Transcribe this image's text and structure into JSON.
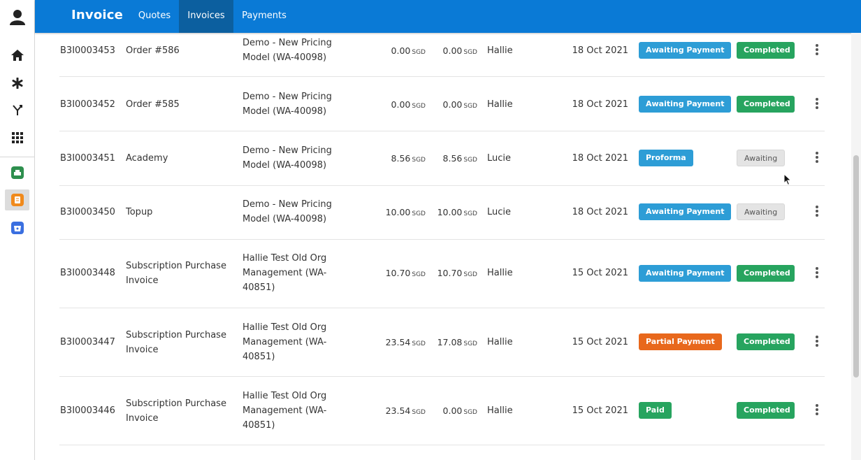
{
  "app": {
    "brand": "Invoice"
  },
  "nav_tabs": [
    {
      "label": "Quotes"
    },
    {
      "label": "Invoices"
    },
    {
      "label": "Payments"
    }
  ],
  "sidebar": {
    "icons": [
      "user-icon",
      "home-icon",
      "asterisk-icon",
      "branch-icon",
      "grid-icon",
      "green-app-icon",
      "orange-app-icon",
      "blue-app-icon"
    ]
  },
  "colors": {
    "topbar": "#0a7ad6",
    "active_tab": "#0c5f9f",
    "awaiting_payment": "#2d9dd6",
    "partial_payment": "#e8681c",
    "paid_completed": "#27a45f",
    "awaiting_gray": "#e4e4e4"
  },
  "rows": [
    {
      "id": "B3I0003453",
      "title": [
        "Order #586"
      ],
      "org": [
        "Demo - New Pricing",
        "Model (WA-40098)"
      ],
      "total": "0.00",
      "total_cur": "SGD",
      "due": "0.00",
      "due_cur": "SGD",
      "owner": "Hallie",
      "date": "18 Oct 2021",
      "status": "Awaiting Payment",
      "state": "Completed"
    },
    {
      "id": "B3I0003452",
      "title": [
        "Order #585"
      ],
      "org": [
        "Demo - New Pricing",
        "Model (WA-40098)"
      ],
      "total": "0.00",
      "total_cur": "SGD",
      "due": "0.00",
      "due_cur": "SGD",
      "owner": "Hallie",
      "date": "18 Oct 2021",
      "status": "Awaiting Payment",
      "state": "Completed"
    },
    {
      "id": "B3I0003451",
      "title": [
        "Academy"
      ],
      "org": [
        "Demo - New Pricing",
        "Model (WA-40098)"
      ],
      "total": "8.56",
      "total_cur": "SGD",
      "due": "8.56",
      "due_cur": "SGD",
      "owner": "Lucie",
      "date": "18 Oct 2021",
      "status": "Proforma",
      "state": "Awaiting"
    },
    {
      "id": "B3I0003450",
      "title": [
        "Topup"
      ],
      "org": [
        "Demo - New Pricing",
        "Model (WA-40098)"
      ],
      "total": "10.00",
      "total_cur": "SGD",
      "due": "10.00",
      "due_cur": "SGD",
      "owner": "Lucie",
      "date": "18 Oct 2021",
      "status": "Awaiting Payment",
      "state": "Awaiting"
    },
    {
      "id": "B3I0003448",
      "title": [
        "Subscription Purchase",
        "Invoice"
      ],
      "org": [
        "Hallie Test Old Org",
        "Management (WA-",
        "40851)"
      ],
      "total": "10.70",
      "total_cur": "SGD",
      "due": "10.70",
      "due_cur": "SGD",
      "owner": "Hallie",
      "date": "15 Oct 2021",
      "status": "Awaiting Payment",
      "state": "Completed"
    },
    {
      "id": "B3I0003447",
      "title": [
        "Subscription Purchase",
        "Invoice"
      ],
      "org": [
        "Hallie Test Old Org",
        "Management (WA-",
        "40851)"
      ],
      "total": "23.54",
      "total_cur": "SGD",
      "due": "17.08",
      "due_cur": "SGD",
      "owner": "Hallie",
      "date": "15 Oct 2021",
      "status": "Partial Payment",
      "state": "Completed"
    },
    {
      "id": "B3I0003446",
      "title": [
        "Subscription Purchase",
        "Invoice"
      ],
      "org": [
        "Hallie Test Old Org",
        "Management (WA-",
        "40851)"
      ],
      "total": "23.54",
      "total_cur": "SGD",
      "due": "0.00",
      "due_cur": "SGD",
      "owner": "Hallie",
      "date": "15 Oct 2021",
      "status": "Paid",
      "state": "Completed"
    }
  ]
}
